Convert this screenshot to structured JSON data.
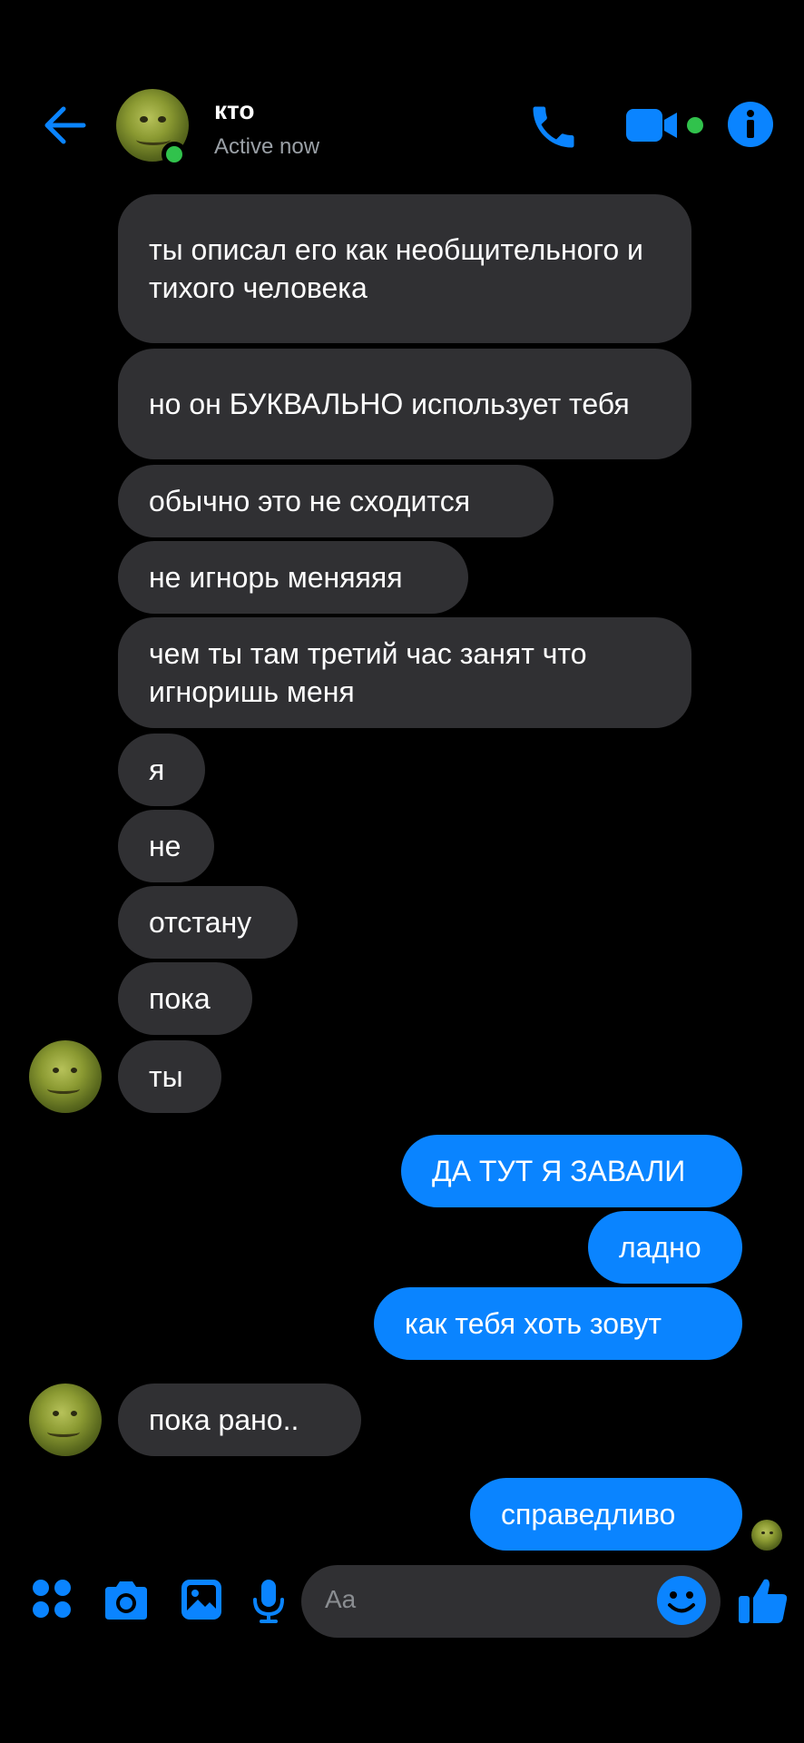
{
  "header": {
    "name": "кто",
    "status": "Active now"
  },
  "messages": [
    {
      "text": "ты описал его как необщительного и тихого человека"
    },
    {
      "text": "но он БУКВАЛЬНО использует тебя"
    },
    {
      "text": "обычно это не сходится"
    },
    {
      "text": "не игнорь меняяяя"
    },
    {
      "text": "чем ты там третий час занят что игноришь меня"
    },
    {
      "text": "я"
    },
    {
      "text": "не"
    },
    {
      "text": "отстану"
    },
    {
      "text": "пока"
    },
    {
      "text": "ты"
    },
    {
      "text": "ДА ТУТ Я ЗАВАЛИ"
    },
    {
      "text": "ладно"
    },
    {
      "text": "как тебя хоть зовут"
    },
    {
      "text": "пока рано.."
    },
    {
      "text": "справедливо"
    }
  ],
  "composer": {
    "placeholder": "Aa"
  },
  "colors": {
    "accent": "#0a84ff",
    "incoming_bubble": "#303033",
    "online": "#31c24c"
  },
  "icons": [
    "back-arrow-icon",
    "phone-icon",
    "video-camera-icon",
    "info-icon",
    "apps-icon",
    "camera-icon",
    "gallery-icon",
    "microphone-icon",
    "emoji-icon",
    "thumbs-up-icon"
  ]
}
